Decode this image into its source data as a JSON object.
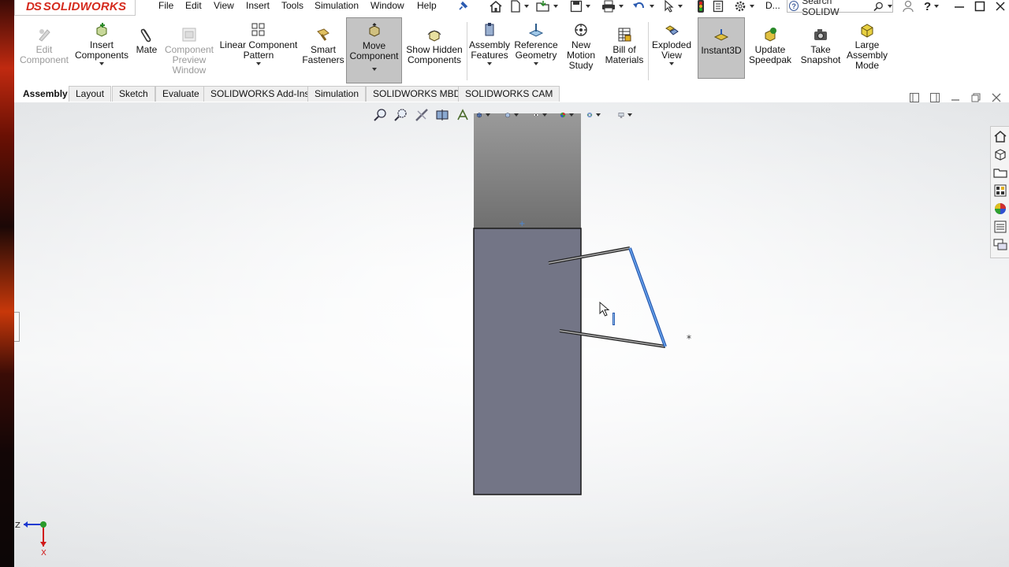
{
  "app": {
    "logo_ds": "DS",
    "logo_name": "SOLIDWORKS",
    "brand_color": "#d52b1e"
  },
  "menu": {
    "items": [
      "File",
      "Edit",
      "View",
      "Insert",
      "Tools",
      "Simulation",
      "Window",
      "Help"
    ],
    "overflow_label": "D...",
    "search_placeholder": "Search SOLIDW"
  },
  "commands": {
    "edit_component": "Edit Component",
    "insert_components": "Insert Components",
    "mate": "Mate",
    "component_preview": "Component Preview Window",
    "linear_pattern": "Linear Component Pattern",
    "smart_fasteners": "Smart Fasteners",
    "move_component": "Move Component",
    "show_hidden": "Show Hidden Components",
    "assembly_features": "Assembly Features",
    "reference_geometry": "Reference Geometry",
    "new_motion_study": "New Motion Study",
    "bill_of_materials": "Bill of Materials",
    "exploded_view": "Exploded View",
    "instant3d": "Instant3D",
    "update_speedpak": "Update Speedpak",
    "take_snapshot": "Take Snapshot",
    "large_assembly_mode": "Large Assembly Mode"
  },
  "tabs": [
    "Assembly",
    "Layout",
    "Sketch",
    "Evaluate",
    "SOLIDWORKS Add-Ins",
    "Simulation",
    "SOLIDWORKS MBD",
    "SOLIDWORKS CAM"
  ],
  "active_tab": "Assembly",
  "triad": {
    "z_label": "Z",
    "x_label": "X"
  },
  "colors": {
    "part_face": "#737586",
    "part_top_gradient_top": "#9a9a9a",
    "part_top_gradient_bottom": "#6f6f6f",
    "linkage_highlight": "#4a88d8",
    "axis_z": "#1a3ad0",
    "axis_x": "#d01a1a",
    "axis_origin": "#2a9a2a"
  },
  "icons": {
    "menu_pin": "pin-icon",
    "home": "home-icon",
    "new": "new-document-icon",
    "open": "open-folder-icon",
    "save": "save-icon",
    "print": "print-icon",
    "undo": "undo-icon",
    "select": "select-arrow-icon",
    "rebuild": "traffic-light-icon",
    "file_properties": "file-properties-icon",
    "options": "gear-icon",
    "user": "user-icon",
    "help": "help-icon"
  }
}
